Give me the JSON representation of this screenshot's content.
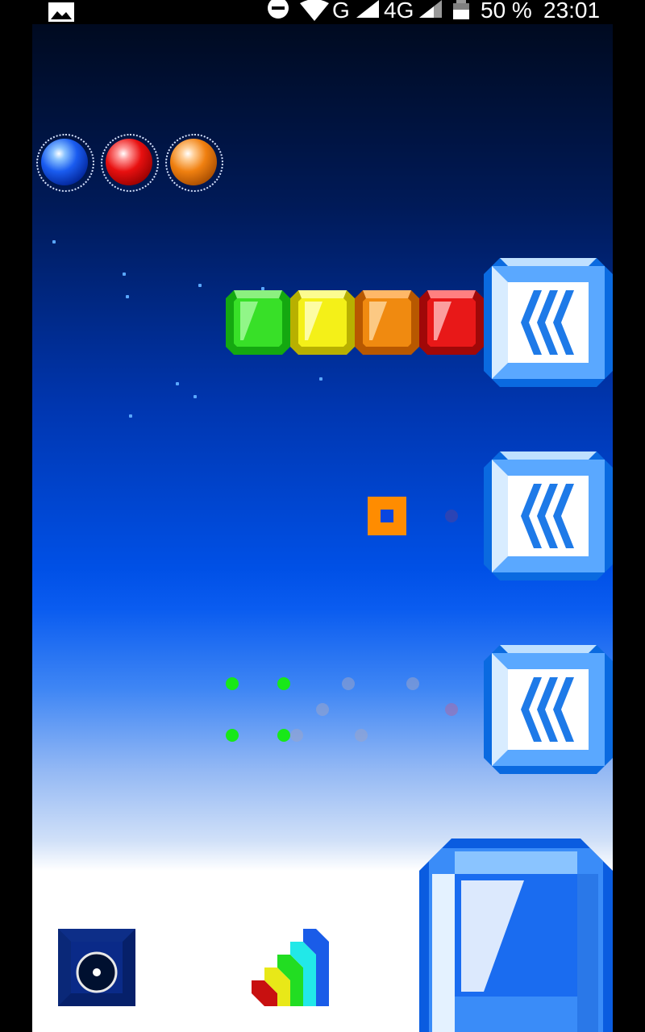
{
  "status_bar": {
    "network_1": "G",
    "network_2": "4G",
    "battery": "50 %",
    "time": "23:01",
    "icons": [
      "gallery-icon",
      "do-not-disturb-icon",
      "wifi-icon",
      "signal-icon",
      "signal-icon",
      "battery-icon"
    ]
  },
  "game": {
    "lives": [
      "blue",
      "red",
      "orange"
    ],
    "gem_row": [
      "green",
      "yellow",
      "orange",
      "red"
    ],
    "arrow_buttons": [
      "push-left",
      "push-left",
      "push-left"
    ],
    "dots_lit": 4,
    "colors": {
      "blue": "#1a6cf0",
      "green": "#22cc11",
      "yellow": "#eeee00",
      "orange": "#ff8800",
      "red": "#e01010",
      "target": "#ff8c00"
    }
  }
}
